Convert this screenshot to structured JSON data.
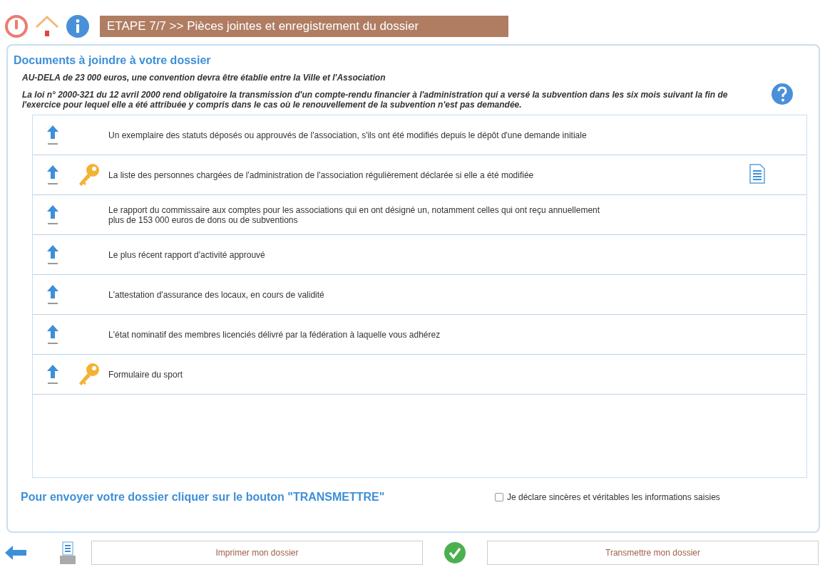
{
  "header": {
    "title": "ETAPE 7/7 >> Pièces jointes et enregistrement du dossier"
  },
  "section": {
    "heading": "Documents à joindre à votre dossier",
    "notes": [
      "AU-DELA de 23 000 euros, une convention devra être établie entre la Ville et l'Association",
      "La loi n° 2000-321 du 12 avril 2000 rend obligatoire la transmission d'un compte-rendu financier à l'administration qui a versé la subvention dans les six mois suivant la fin de l'exercice pour lequel elle a été attribuée y compris dans le cas où le renouvellement de la subvention n'est pas demandée."
    ],
    "documents": [
      {
        "label": "Un exemplaire des statuts déposés ou approuvés de l'association, s'ils ont été modifiés depuis le dépôt d'une demande initiale",
        "required": false,
        "attached": false
      },
      {
        "label": "La liste des personnes chargées de l'administration de l'association régulièrement déclarée si elle a été modifiée",
        "required": true,
        "attached": true
      },
      {
        "label": "Le rapport du commissaire aux comptes pour les associations qui en ont désigné un, notamment celles qui ont reçu annuellement\nplus de 153 000 euros de dons ou de subventions",
        "required": false,
        "attached": false
      },
      {
        "label": "Le plus récent rapport d'activité approuvé",
        "required": false,
        "attached": false
      },
      {
        "label": "L'attestation d'assurance des locaux, en cours de validité",
        "required": false,
        "attached": false
      },
      {
        "label": "L'état nominatif des membres licenciés délivré par la fédération à laquelle vous adhérez",
        "required": false,
        "attached": false
      },
      {
        "label": "Formulaire du sport",
        "required": true,
        "attached": false
      }
    ]
  },
  "footer": {
    "instruction": "Pour envoyer votre dossier cliquer sur le bouton \"TRANSMETTRE\"",
    "declaration": {
      "label": "Je déclare sincères et véritables les informations saisies",
      "checked": false
    }
  },
  "buttons": [
    "Imprimer mon dossier",
    "Transmettre mon dossier"
  ]
}
